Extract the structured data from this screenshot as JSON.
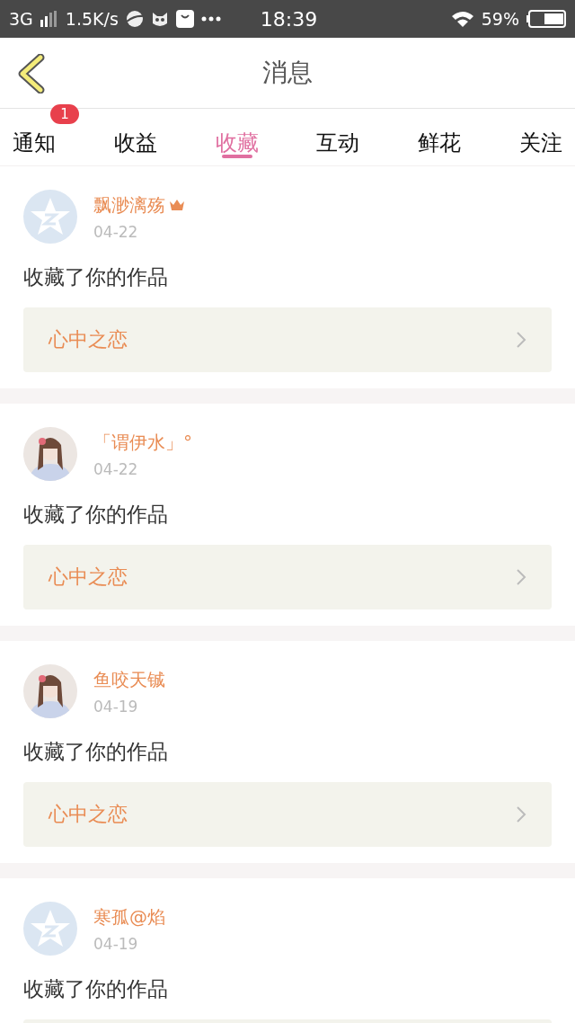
{
  "status_bar": {
    "network": "3G",
    "speed": "1.5K/s",
    "time": "18:39",
    "battery": "59%"
  },
  "header": {
    "title": "消息"
  },
  "tabs": [
    {
      "label": "通知",
      "selected": false,
      "badge": "1"
    },
    {
      "label": "收益",
      "selected": false
    },
    {
      "label": "收藏",
      "selected": true
    },
    {
      "label": "互动",
      "selected": false
    },
    {
      "label": "鲜花",
      "selected": false
    },
    {
      "label": "关注",
      "selected": false
    }
  ],
  "messages": [
    {
      "kind": "default",
      "name": "飘渺漓殇",
      "crown": true,
      "date": "04-22",
      "text": "收藏了你的作品",
      "work": "心中之恋"
    },
    {
      "kind": "picture",
      "name": "「谓伊水」°",
      "crown": false,
      "date": "04-22",
      "text": "收藏了你的作品",
      "work": "心中之恋"
    },
    {
      "kind": "picture",
      "name": "鱼咬天铖",
      "crown": false,
      "date": "04-19",
      "text": "收藏了你的作品",
      "work": "心中之恋"
    },
    {
      "kind": "default",
      "name": "寒孤@焰",
      "crown": false,
      "date": "04-19",
      "text": "收藏了你的作品"
    }
  ]
}
